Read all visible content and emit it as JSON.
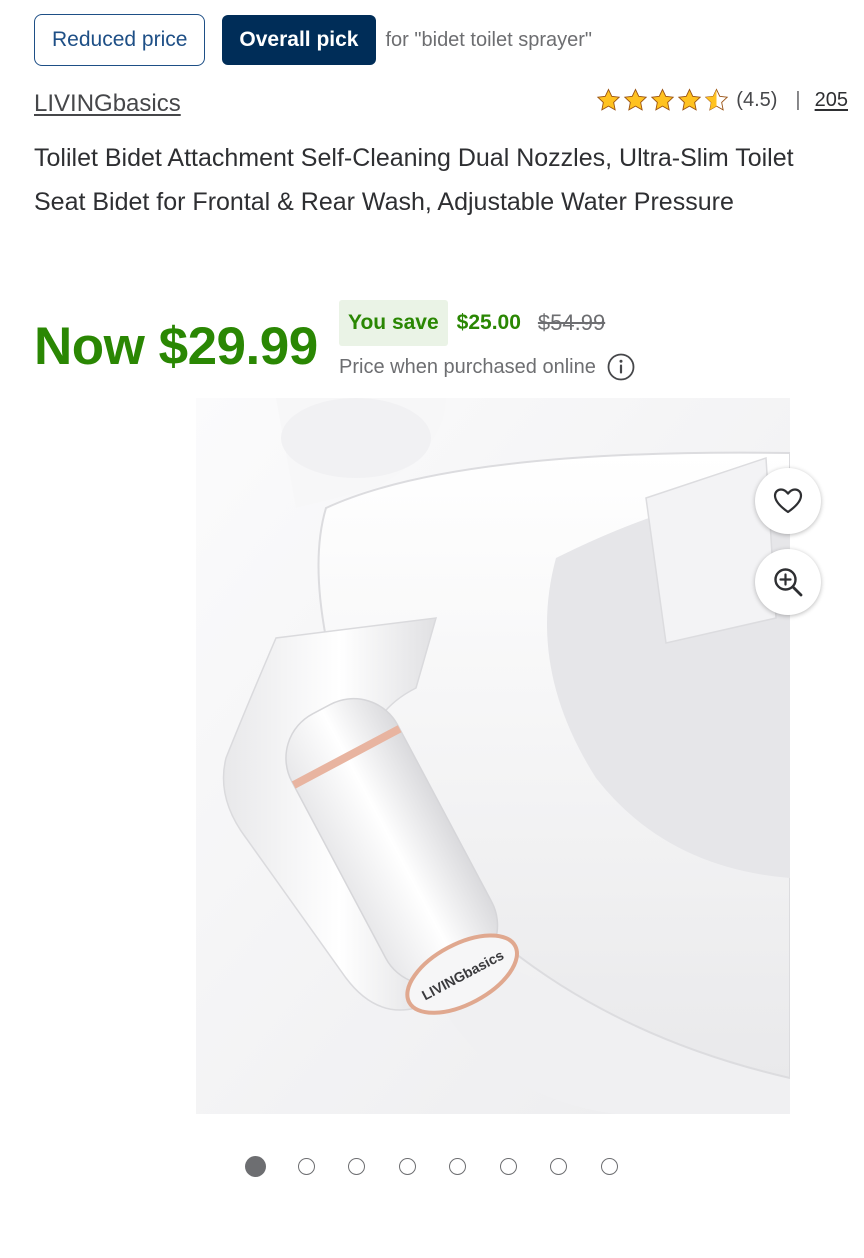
{
  "badges": {
    "reduced": "Reduced price",
    "overall": "Overall pick",
    "for_text": "for \"bidet toilet sprayer\""
  },
  "product": {
    "brand": "LIVINGbasics",
    "title": "Tolilet Bidet Attachment Self-Cleaning Dual Nozzles, Ultra-Slim Toilet Seat Bidet for Frontal & Rear Wash, Adjustable Water Pressure",
    "rating": 4.5,
    "rating_text": "(4.5)",
    "review_count": "205",
    "separator": "|"
  },
  "price": {
    "now": "Now $29.99",
    "you_save_label": "You save",
    "save_amount": "$25.00",
    "was": "$54.99",
    "note": "Price when purchased online"
  },
  "image_label": "LIVINGbasics",
  "gallery": {
    "total": 8,
    "active_index": 0
  },
  "icons": {
    "favorite": "heart-icon",
    "zoom": "zoom-in-icon",
    "info": "info-icon",
    "star": "star-icon"
  },
  "colors": {
    "price_green": "#2a8703",
    "save_bg": "#eaf3e6",
    "navy": "#002d58",
    "blue": "#1e4f86",
    "star": "#ffc220"
  }
}
